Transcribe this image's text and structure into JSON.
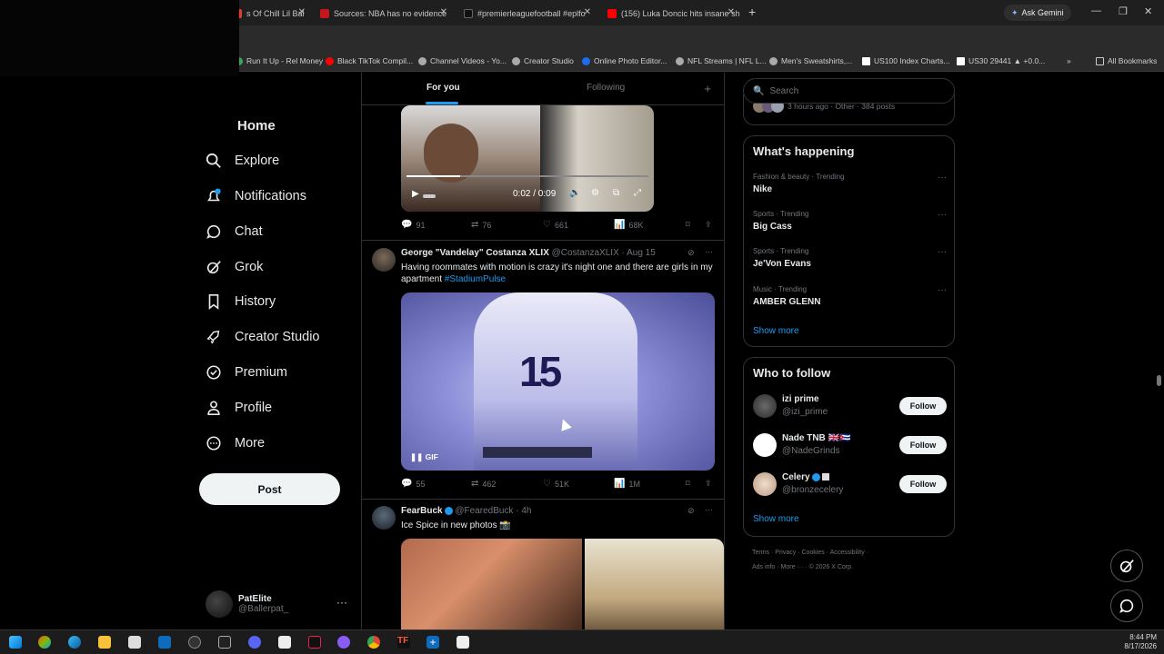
{
  "browser": {
    "tabs": [
      {
        "title": "s Of Chill Lil Bal",
        "color": "#e33b2e"
      },
      {
        "title": "Sources: NBA has no evidence",
        "color": "#c4161c"
      },
      {
        "title": "#premierleaguefootball #eplfo",
        "color": "#111111"
      },
      {
        "title": "(156) Luka Doncic hits insane sh",
        "color": "#ff0000"
      }
    ],
    "gemini_label": "Ask Gemini",
    "bookmarks": [
      {
        "label": "Run It Up - Rel Money",
        "color": "#3aa757"
      },
      {
        "label": "Black TikTok Compil...",
        "color": "#ff0000"
      },
      {
        "label": "Channel Videos - Yo...",
        "color": "#aaaaaa"
      },
      {
        "label": "Creator Studio",
        "color": "#aaaaaa"
      },
      {
        "label": "Online Photo Editor...",
        "color": "#1d6cf0"
      },
      {
        "label": "NFL Streams | NFL L...",
        "color": "#aaaaaa"
      },
      {
        "label": "Men's Sweatshirts,...",
        "color": "#aaaaaa"
      },
      {
        "label": "US100 Index Charts...",
        "color": "#ffffff"
      },
      {
        "label": "US30 29441 ▲ +0.0...",
        "color": "#ffffff"
      }
    ],
    "all_bookmarks": "All Bookmarks"
  },
  "nav": {
    "home": "Home",
    "items": [
      {
        "label": "Explore",
        "icon": "search-icon"
      },
      {
        "label": "Notifications",
        "icon": "bell-icon",
        "badge": "1"
      },
      {
        "label": "Chat",
        "icon": "chat-icon"
      },
      {
        "label": "Grok",
        "icon": "grok-icon"
      },
      {
        "label": "History",
        "icon": "bookmark-icon"
      },
      {
        "label": "Creator Studio",
        "icon": "rocket-icon"
      },
      {
        "label": "Premium",
        "icon": "verified-icon"
      },
      {
        "label": "Profile",
        "icon": "person-icon"
      },
      {
        "label": "More",
        "icon": "more-circle-icon"
      }
    ],
    "post_label": "Post",
    "account": {
      "name": "PatElite",
      "handle": "@Ballerpat_"
    }
  },
  "feed": {
    "tabs": [
      {
        "label": "For you",
        "active": true
      },
      {
        "label": "Following",
        "active": false
      }
    ],
    "tweet1": {
      "video_time": "0:02 / 0:09",
      "progress": 0.22,
      "metrics": {
        "replies": "91",
        "reposts": "76",
        "likes": "661",
        "views": "68K"
      }
    },
    "tweet2": {
      "name": "George \"Vandelay\" Costanza XLIX",
      "handle": "@CostanzaXLIX",
      "date": "Aug 15",
      "text": "Having roommates with motion is crazy it's night one and there are girls in my apartment",
      "hashtag": "#StadiumPulse",
      "gif_label": "GIF",
      "jersey_number": "15",
      "metrics": {
        "replies": "55",
        "reposts": "462",
        "likes": "51K",
        "views": "1M"
      }
    },
    "tweet3": {
      "name": "FearBuck",
      "handle": "@FearedBuck",
      "date": "4h",
      "text": "Ice Spice in new photos 📸"
    }
  },
  "sidebar": {
    "search_placeholder": "Search",
    "top_meta": "3 hours ago · Other · 384 posts",
    "whats_happening": "What's happening",
    "trends": [
      {
        "context": "Fashion & beauty · Trending",
        "title": "Nike"
      },
      {
        "context": "Sports · Trending",
        "title": "Big Cass"
      },
      {
        "context": "Sports · Trending",
        "title": "Je'Von Evans"
      },
      {
        "context": "Music · Trending",
        "title": "AMBER GLENN"
      }
    ],
    "show_more": "Show more",
    "who_to_follow": "Who to follow",
    "follow_label": "Follow",
    "suggestions": [
      {
        "name": "izi prime",
        "handle": "@izi_prime",
        "color": "#5a5a5a"
      },
      {
        "name": "Nade TNB 🇬🇧🇨🇺",
        "handle": "@NadeGrinds",
        "color": "#ffffff"
      },
      {
        "name": "Celery",
        "handle": "@bronzecelery",
        "color": "#e8d4c4"
      }
    ],
    "footer_line1": "Terms · Privacy · Cookies · Accessibility ·",
    "footer_line2": "Ads info · More ··· · © 2026 X Corp."
  },
  "taskbar": {
    "time": "8:44 PM",
    "date": "8/17/2026"
  }
}
